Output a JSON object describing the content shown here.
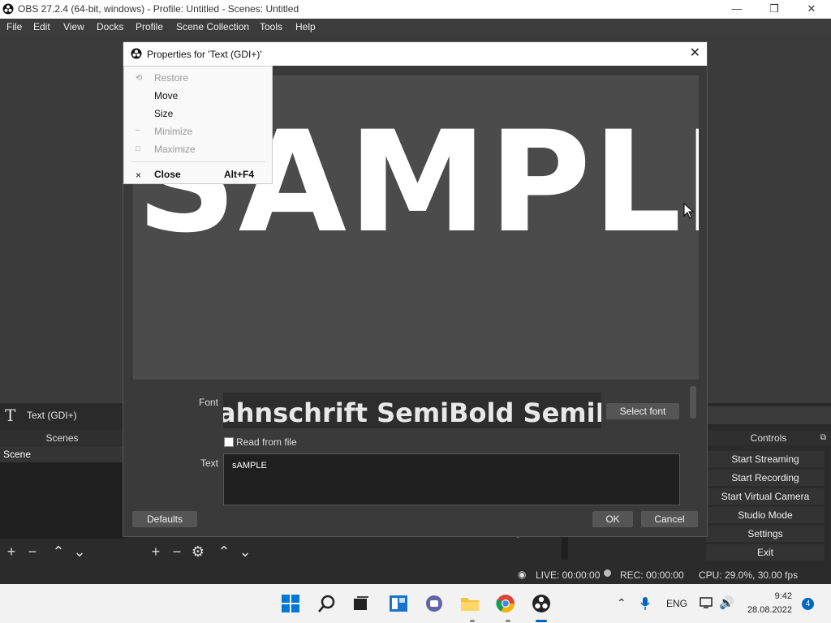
{
  "window": {
    "title": "OBS 27.2.4 (64-bit, windows) - Profile: Untitled - Scenes: Untitled",
    "minimize_glyph": "—",
    "maximize_glyph": "❐",
    "close_glyph": "✕"
  },
  "menubar": {
    "items": [
      "File",
      "Edit",
      "View",
      "Docks",
      "Profile",
      "Scene Collection",
      "Tools",
      "Help"
    ]
  },
  "source_bar": {
    "icon": "T",
    "label": "Text (GDI+)"
  },
  "docks": {
    "scenes_header": "Scenes",
    "controls_header": "Controls",
    "scenes": [
      "Scene"
    ]
  },
  "controls": {
    "buttons": [
      "Start Streaming",
      "Start Recording",
      "Start Virtual Camera",
      "Studio Mode",
      "Settings",
      "Exit"
    ]
  },
  "statusbar": {
    "live": "LIVE: 00:00:00",
    "rec": "REC: 00:00:00",
    "cpu": "CPU: 29.0%, 30.00 fps"
  },
  "dialog": {
    "title": "Properties for 'Text (GDI+)'",
    "close_glyph": "✕",
    "preview_text": "SAMPLE",
    "font_label": "Font",
    "font_value": "ahnschrift SemiBold SemiBo",
    "select_font": "Select font",
    "read_from_file": "Read from file",
    "text_label": "Text",
    "text_value": "sAMPLE",
    "defaults": "Defaults",
    "ok": "OK",
    "cancel": "Cancel"
  },
  "context_menu": {
    "restore": "Restore",
    "move": "Move",
    "size": "Size",
    "minimize": "Minimize",
    "maximize": "Maximize",
    "close": "Close",
    "close_shortcut": "Alt+F4",
    "close_glyph": "×"
  },
  "taskbar": {
    "lang": "ENG",
    "time": "9:42",
    "date": "28.08.2022",
    "notifications": "4"
  },
  "colors": {
    "accent": "#0067c0",
    "dock_bg": "#2b2b2b",
    "dialog_bg": "#3a3a3a"
  }
}
